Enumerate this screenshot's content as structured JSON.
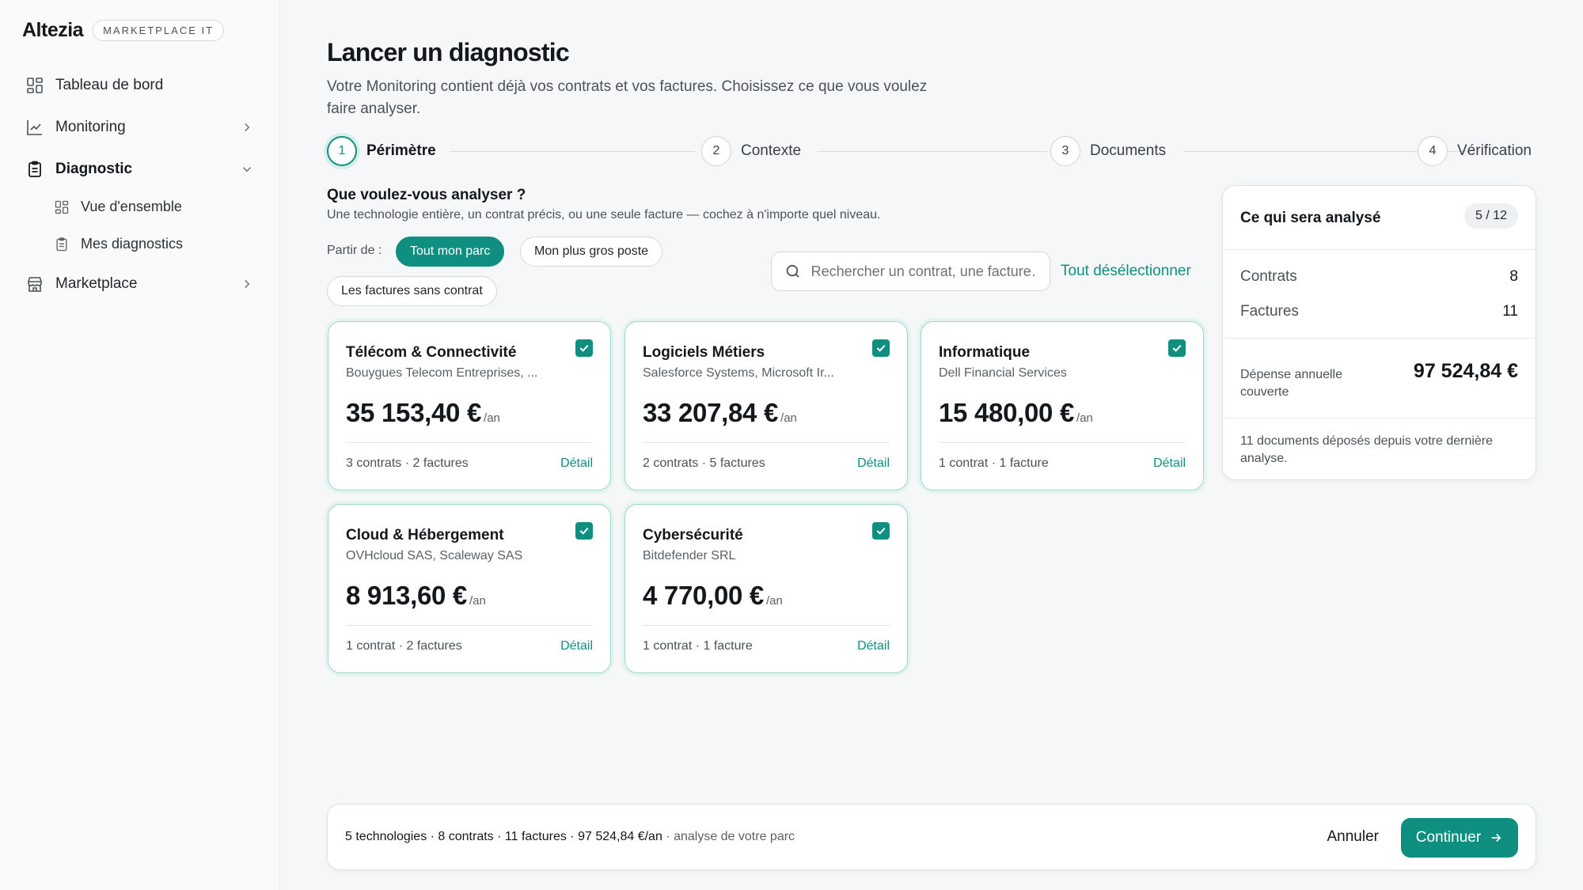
{
  "sidebar": {
    "brand": "Altezia",
    "badge": "MARKETPLACE IT",
    "items": [
      {
        "label": "Tableau de bord"
      },
      {
        "label": "Monitoring"
      },
      {
        "label": "Diagnostic"
      },
      {
        "label": "Marketplace"
      }
    ],
    "subitems": [
      {
        "label": "Vue d'ensemble"
      },
      {
        "label": "Mes diagnostics"
      }
    ]
  },
  "page": {
    "title": "Lancer un diagnostic",
    "subtitle": "Votre Monitoring contient déjà vos contrats et vos factures. Choisissez ce que vous voulez faire analyser."
  },
  "stepper": [
    {
      "num": "1",
      "label": "Périmètre"
    },
    {
      "num": "2",
      "label": "Contexte"
    },
    {
      "num": "3",
      "label": "Documents"
    },
    {
      "num": "4",
      "label": "Vérification"
    }
  ],
  "question": {
    "title": "Que voulez-vous analyser ?",
    "subtitle": "Une technologie entière, un contrat précis, ou une seule facture — cochez à n'importe quel niveau."
  },
  "filters": {
    "label": "Partir de :",
    "chips": [
      "Tout mon parc",
      "Mon plus gros poste",
      "Les factures sans contrat"
    ]
  },
  "search": {
    "placeholder": "Rechercher un contrat, une facture…"
  },
  "deselect_label": "Tout désélectionner",
  "cards": [
    {
      "title": "Télécom & Connectivité",
      "vendors": "Bouygues Telecom Entreprises, ...",
      "amount": "35 153,40 €",
      "per": "/an",
      "meta": "3 contrats · 2 factures",
      "detail": "Détail"
    },
    {
      "title": "Logiciels Métiers",
      "vendors": "Salesforce Systems, Microsoft Ir...",
      "amount": "33 207,84 €",
      "per": "/an",
      "meta": "2 contrats · 5 factures",
      "detail": "Détail"
    },
    {
      "title": "Informatique",
      "vendors": "Dell Financial Services",
      "amount": "15 480,00 €",
      "per": "/an",
      "meta": "1 contrat · 1 facture",
      "detail": "Détail"
    },
    {
      "title": "Cloud & Hébergement",
      "vendors": "OVHcloud SAS, Scaleway SAS",
      "amount": "8 913,60 €",
      "per": "/an",
      "meta": "1 contrat · 2 factures",
      "detail": "Détail"
    },
    {
      "title": "Cybersécurité",
      "vendors": "Bitdefender SRL",
      "amount": "4 770,00 €",
      "per": "/an",
      "meta": "1 contrat · 1 facture",
      "detail": "Détail"
    }
  ],
  "summary": {
    "title": "Ce qui sera analysé",
    "badge": "5 / 12",
    "contracts_label": "Contrats",
    "contracts_value": "8",
    "invoices_label": "Factures",
    "invoices_value": "11",
    "spend_label": "Dépense annuelle couverte",
    "spend_value": "97 524,84 €",
    "note": "11 documents déposés depuis votre dernière analyse."
  },
  "footer": {
    "summary": "5 technologies · 8 contrats · 11 factures · 97 524,84 €/an",
    "suffix": " · analyse de votre parc",
    "cancel": "Annuler",
    "continue": "Continuer"
  },
  "colors": {
    "accent": "#0f8f7f"
  }
}
